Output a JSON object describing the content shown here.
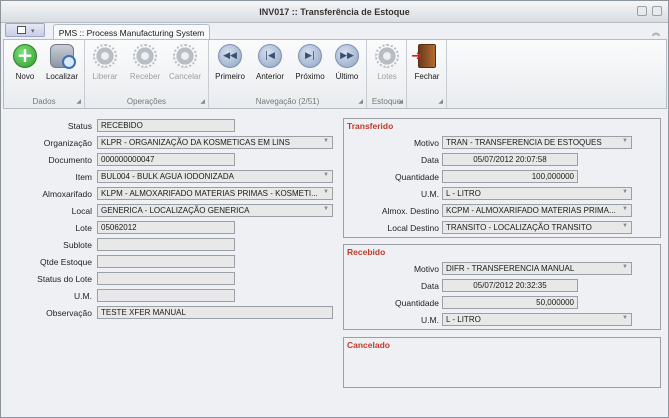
{
  "window": {
    "title": "INV017 :: Transferência de Estoque"
  },
  "ribbon": {
    "tab_label": "PMS :: Process Manufacturing System",
    "groups": {
      "dados": {
        "label": "Dados",
        "novo": "Novo",
        "localizar": "Localizar"
      },
      "operacoes": {
        "label": "Operações",
        "liberar": "Liberar",
        "receber": "Receber",
        "cancelar": "Cancelar"
      },
      "navegacao": {
        "label": "Navegação (2/51)",
        "primeiro": "Primeiro",
        "anterior": "Anterior",
        "proximo": "Próximo",
        "ultimo": "Último"
      },
      "estoque": {
        "label": "Estoque",
        "lotes": "Lotes"
      },
      "sair": {
        "label": "",
        "fechar": "Fechar"
      }
    }
  },
  "form": {
    "labels": {
      "status": "Status",
      "organizacao": "Organização",
      "documento": "Documento",
      "item": "Item",
      "almoxarifado": "Almoxarifado",
      "local": "Local",
      "lote": "Lote",
      "sublote": "Sublote",
      "qtde_estoque": "Qtde Estoque",
      "status_lote": "Status do Lote",
      "um": "U.M.",
      "observacao": "Observação"
    },
    "values": {
      "status": "RECEBIDO",
      "organizacao": "KLPR - ORGANIZAÇÃO DA KOSMETICAS EM LINS",
      "documento": "000000000047",
      "item": "BUL004 - BULK AGUA IODONIZADA",
      "almoxarifado": "KLPM - ALMOXARIFADO MATERIAS PRIMAS - KOSMETI...",
      "local": "GENERICA - LOCALIZAÇÃO GENERICA",
      "lote": "05062012",
      "sublote": "",
      "qtde_estoque": "",
      "status_lote": "",
      "um": "",
      "observacao": "TESTE XFER MANUAL"
    }
  },
  "transferido": {
    "title": "Transferido",
    "labels": {
      "motivo": "Motivo",
      "data": "Data",
      "quantidade": "Quantidade",
      "um": "U.M.",
      "almox_destino": "Almox. Destino",
      "local_destino": "Local Destino"
    },
    "values": {
      "motivo": "TRAN - TRANSFERENCIA DE ESTOQUES",
      "data": "05/07/2012 20:07:58",
      "quantidade": "100,000000",
      "um": "L - LITRO",
      "almox_destino": "KCPM - ALMOXARIFADO MATERIAS PRIMA...",
      "local_destino": "TRANSITO - LOCALIZAÇÃO TRANSITO"
    }
  },
  "recebido": {
    "title": "Recebido",
    "labels": {
      "motivo": "Motivo",
      "data": "Data",
      "quantidade": "Quantidade",
      "um": "U.M."
    },
    "values": {
      "motivo": "DIFR - TRANSFERENCIA MANUAL",
      "data": "05/07/2012 20:32:35",
      "quantidade": "50,000000",
      "um": "L - LITRO"
    }
  },
  "cancelado": {
    "title": "Cancelado"
  },
  "glyphs": {
    "dropdown": "▼",
    "collapse": "︽",
    "first": "◀◀",
    "prev": "|◀",
    "next": "▶|",
    "last": "▶▶",
    "qat_dropdown": "▾"
  }
}
